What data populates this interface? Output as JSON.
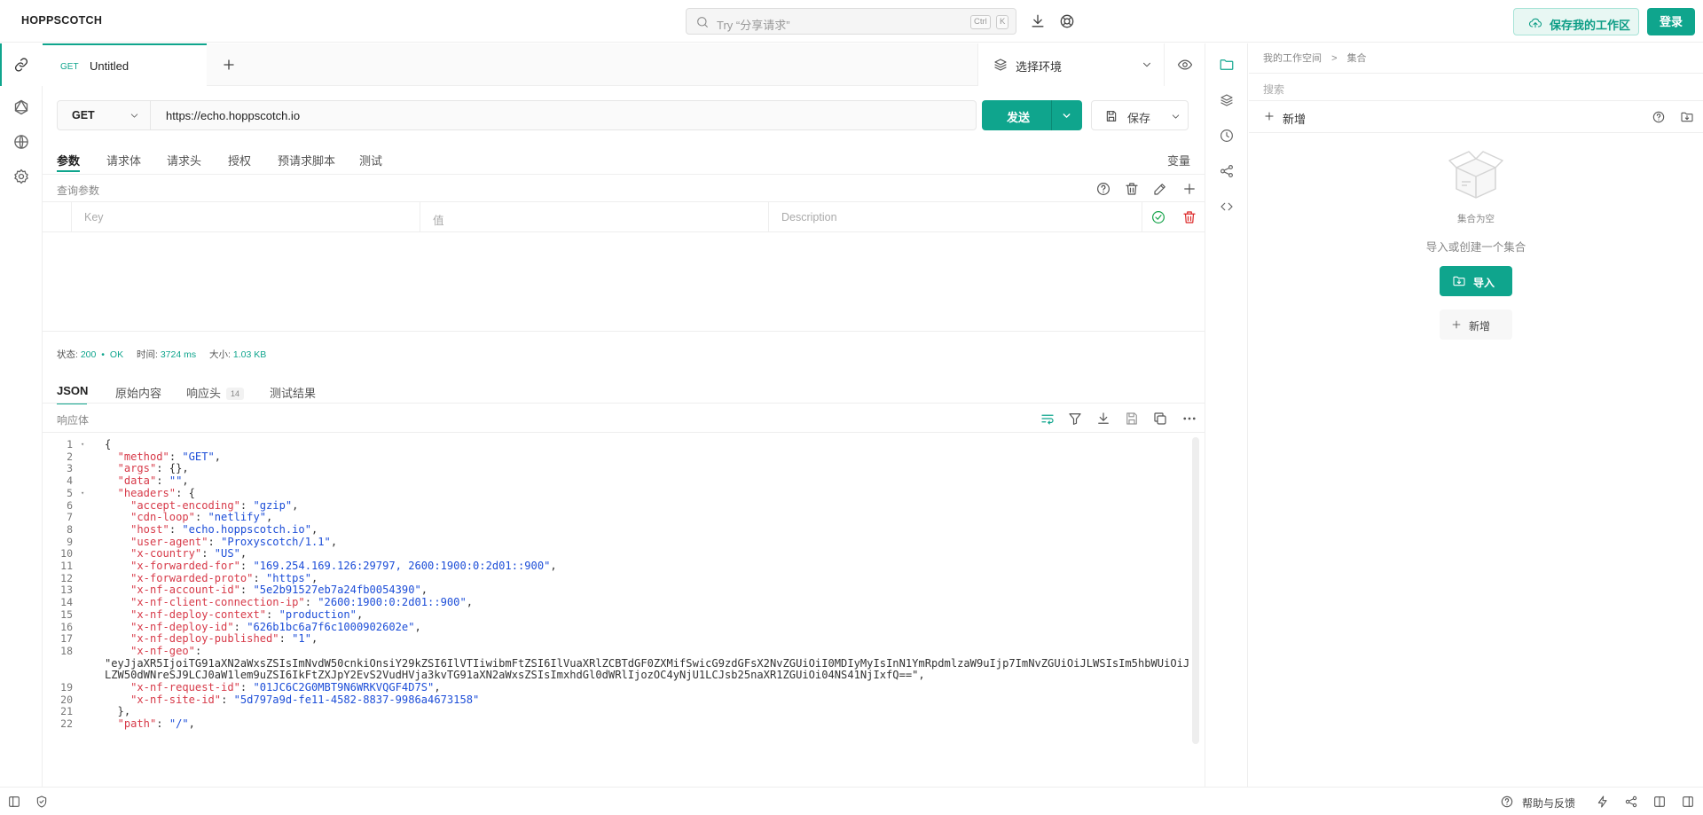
{
  "app": {
    "name": "HOPPSCOTCH"
  },
  "header": {
    "search_placeholder": "Try “分享请求”",
    "kbd_ctrl": "Ctrl",
    "kbd_k": "K",
    "save_workspace": "保存我的工作区",
    "login": "登录"
  },
  "tab": {
    "method": "GET",
    "title": "Untitled"
  },
  "env": {
    "label": "选择环境"
  },
  "request": {
    "method": "GET",
    "url": "https://echo.hoppscotch.io",
    "send": "发送",
    "save": "保存",
    "tabs": [
      "参数",
      "请求体",
      "请求头",
      "授权",
      "预请求脚本",
      "测试"
    ],
    "variables": "变量",
    "query_params_label": "查询参数",
    "kv": {
      "key": "Key",
      "value": "值",
      "description": "Description"
    }
  },
  "status": {
    "label": "状态:",
    "code": "200",
    "dot": "•",
    "text": "OK",
    "time_label": "时间:",
    "time": "3724 ms",
    "size_label": "大小:",
    "size": "1.03 KB"
  },
  "response": {
    "tabs": [
      "JSON",
      "原始内容",
      "响应头",
      "测试结果"
    ],
    "headers_count": "14",
    "body_label": "响应体",
    "lines": [
      {
        "n": "1",
        "t": "{"
      },
      {
        "n": "2",
        "t": "  \"method\": \"GET\","
      },
      {
        "n": "3",
        "t": "  \"args\": {},"
      },
      {
        "n": "4",
        "t": "  \"data\": \"\","
      },
      {
        "n": "5",
        "t": "  \"headers\": {"
      },
      {
        "n": "6",
        "t": "    \"accept-encoding\": \"gzip\","
      },
      {
        "n": "7",
        "t": "    \"cdn-loop\": \"netlify\","
      },
      {
        "n": "8",
        "t": "    \"host\": \"echo.hoppscotch.io\","
      },
      {
        "n": "9",
        "t": "    \"user-agent\": \"Proxyscotch/1.1\","
      },
      {
        "n": "10",
        "t": "    \"x-country\": \"US\","
      },
      {
        "n": "11",
        "t": "    \"x-forwarded-for\": \"169.254.169.126:29797, 2600:1900:0:2d01::900\","
      },
      {
        "n": "12",
        "t": "    \"x-forwarded-proto\": \"https\","
      },
      {
        "n": "13",
        "t": "    \"x-nf-account-id\": \"5e2b91527eb7a24fb0054390\","
      },
      {
        "n": "14",
        "t": "    \"x-nf-client-connection-ip\": \"2600:1900:0:2d01::900\","
      },
      {
        "n": "15",
        "t": "    \"x-nf-deploy-context\": \"production\","
      },
      {
        "n": "16",
        "t": "    \"x-nf-deploy-id\": \"626b1bc6a7f6c1000902602e\","
      },
      {
        "n": "17",
        "t": "    \"x-nf-deploy-published\": \"1\","
      },
      {
        "n": "18",
        "t": "    \"x-nf-geo\":"
      },
      {
        "n": "",
        "t": "\"eyJjaXR5IjoiTG91aXN2aWxsZSIsImNvdW50cnkiOnsiY29kZSI6IlVTIiwibmFtZSI6IlVuaXRlZCBTdGF0ZXMifSwicG9zdGFsX2NvZGUiOiI0MDIyMyIsInN1YmRpdmlzaW9uIjp7ImNvZGUiOiJLWSIsIm5hbWUiOiJ"
      },
      {
        "n": "",
        "t": "LZW50dWNreSJ9LCJ0aW1lem9uZSI6IkFtZXJpY2EvS2VudHVja3kvTG91aXN2aWxsZSIsImxhdGl0dWRlIjozOC4yNjU1LCJsb25naXR1ZGUiOi04NS41NjIxfQ==\","
      },
      {
        "n": "19",
        "t": "    \"x-nf-request-id\": \"01JC6C2G0MBT9N6WRKVQGF4D7S\","
      },
      {
        "n": "20",
        "t": "    \"x-nf-site-id\": \"5d797a9d-fe11-4582-8837-9986a4673158\""
      },
      {
        "n": "21",
        "t": "  },"
      },
      {
        "n": "22",
        "t": "  \"path\": \"/\","
      }
    ]
  },
  "collections": {
    "breadcrumb_workspace": "我的工作空间",
    "breadcrumb_sep": ">",
    "breadcrumb_current": "集合",
    "search_placeholder": "搜索",
    "new": "新增",
    "empty_title": "集合为空",
    "empty_desc": "导入或创建一个集合",
    "import": "导入",
    "new_btn": "新增"
  },
  "footer": {
    "help": "帮助与反馈"
  },
  "colors": {
    "accent": "#0fa58d",
    "key": "#d73a49",
    "string": "#1d4ed8"
  }
}
